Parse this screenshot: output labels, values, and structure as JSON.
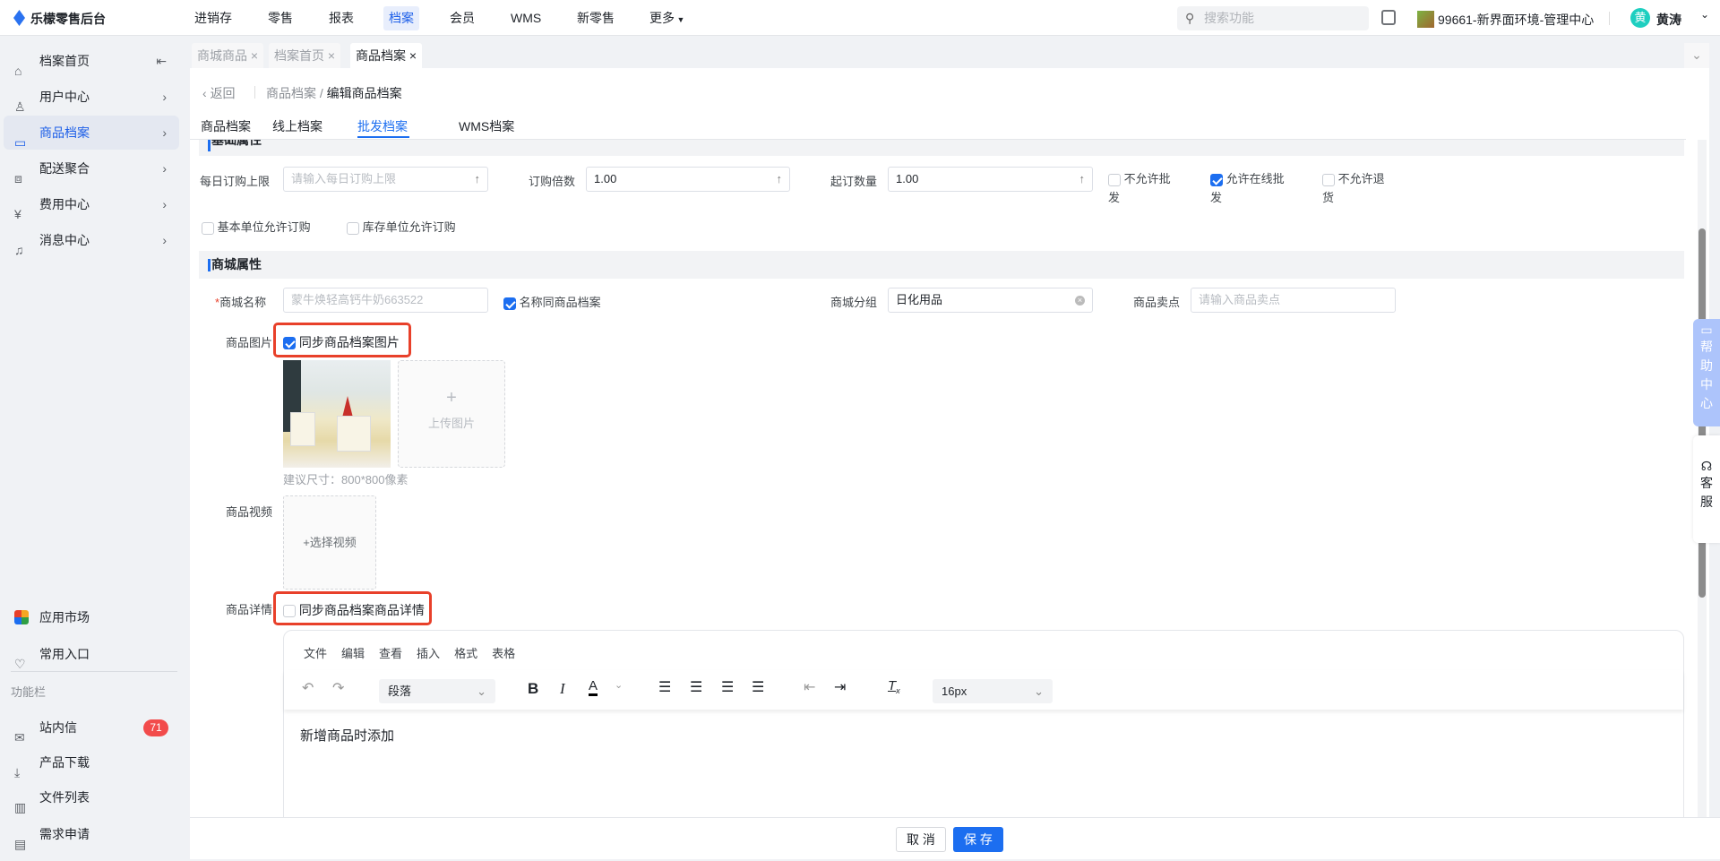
{
  "app": {
    "title": "乐檬零售后台"
  },
  "topnav": [
    "进销存",
    "零售",
    "报表",
    "档案",
    "会员",
    "WMS",
    "新零售",
    "更多"
  ],
  "header": {
    "search_placeholder": "搜索功能",
    "store": "99661-新界面环境-管理中心",
    "avatar_char": "黄",
    "user": "黄涛"
  },
  "sidebar": {
    "items": [
      {
        "label": "档案首页"
      },
      {
        "label": "用户中心"
      },
      {
        "label": "商品档案"
      },
      {
        "label": "配送聚合"
      },
      {
        "label": "费用中心"
      },
      {
        "label": "消息中心"
      }
    ],
    "bottom": {
      "app_market": "应用市场",
      "favorites": "常用入口",
      "section": "功能栏",
      "messages": "站内信",
      "messages_badge": "71",
      "downloads": "产品下载",
      "files": "文件列表",
      "requests": "需求申请"
    }
  },
  "tabs": [
    {
      "label": "商城商品"
    },
    {
      "label": "档案首页"
    },
    {
      "label": "商品档案"
    }
  ],
  "breadcrumb": {
    "back": "返回",
    "parent": "商品档案",
    "current": "编辑商品档案"
  },
  "subtabs": [
    "商品档案",
    "线上档案",
    "批发档案",
    "WMS档案"
  ],
  "basic": {
    "title": "基础属性",
    "daily_limit_label": "每日订购上限",
    "daily_limit_placeholder": "请输入每日订购上限",
    "multiple_label": "订购倍数",
    "multiple_value": "1.00",
    "min_qty_label": "起订数量",
    "min_qty_value": "1.00",
    "no_wholesale": "不允许批发",
    "online_wholesale": "允许在线批发",
    "no_return": "不允许退货",
    "base_unit": "基本单位允许订购",
    "stock_unit": "库存单位允许订购"
  },
  "mall": {
    "title": "商城属性",
    "name_label": "商城名称",
    "name_placeholder": "蒙牛焕轻高钙牛奶663522",
    "same_name": "名称同商品档案",
    "group_label": "商城分组",
    "group_value": "日化用品",
    "selling_label": "商品卖点",
    "selling_placeholder": "请输入商品卖点",
    "image_label": "商品图片",
    "sync_image": "同步商品档案图片",
    "upload_image": "上传图片",
    "size_hint": "建议尺寸：800*800像素",
    "video_label": "商品视频",
    "choose_video": "+选择视频",
    "detail_label": "商品详情",
    "sync_detail": "同步商品档案商品详情"
  },
  "editor": {
    "menu": [
      "文件",
      "编辑",
      "查看",
      "插入",
      "格式",
      "表格"
    ],
    "block": "段落",
    "font_size": "16px",
    "content": "新增商品时添加"
  },
  "footer": {
    "cancel": "取 消",
    "save": "保 存"
  },
  "float": {
    "help": "帮助中心",
    "service": "客服"
  }
}
